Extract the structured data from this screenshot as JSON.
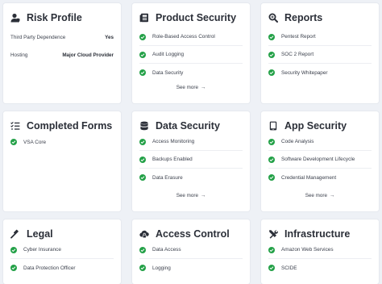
{
  "cards": {
    "risk_profile": {
      "title": "Risk Profile",
      "icon": "user-shield-icon",
      "rows": [
        {
          "label": "Third Party Dependence",
          "value": "Yes"
        },
        {
          "label": "Hosting",
          "value": "Major Cloud Provider"
        }
      ]
    },
    "product_security": {
      "title": "Product Security",
      "icon": "document-icon",
      "items": [
        "Role-Based Access Control",
        "Audit Logging",
        "Data Security"
      ],
      "see_more": "See more"
    },
    "reports": {
      "title": "Reports",
      "icon": "magnifier-icon",
      "items": [
        "Pentest Report",
        "SOC 2 Report",
        "Security Whitepaper"
      ]
    },
    "completed_forms": {
      "title": "Completed Forms",
      "icon": "checklist-icon",
      "items": [
        "VSA Core"
      ]
    },
    "data_security": {
      "title": "Data Security",
      "icon": "database-icon",
      "items": [
        "Access Monitoring",
        "Backups Enabled",
        "Data Erasure"
      ],
      "see_more": "See more"
    },
    "app_security": {
      "title": "App Security",
      "icon": "tablet-icon",
      "items": [
        "Code Analysis",
        "Software Development Lifecycle",
        "Credential Management"
      ],
      "see_more": "See more"
    },
    "legal": {
      "title": "Legal",
      "icon": "gavel-icon",
      "items": [
        "Cyber Insurance",
        "Data Protection Officer"
      ]
    },
    "access_control": {
      "title": "Access Control",
      "icon": "cloud-lock-icon",
      "items": [
        "Data Access",
        "Logging"
      ]
    },
    "infrastructure": {
      "title": "Infrastructure",
      "icon": "tools-icon",
      "items": [
        "Amazon Web Services",
        "SCIDE"
      ]
    }
  },
  "colors": {
    "check": "#24a148",
    "card_bg": "#ffffff",
    "page_bg": "#eef1f6"
  }
}
